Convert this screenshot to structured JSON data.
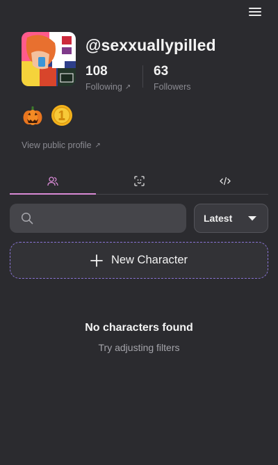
{
  "header": {
    "menu_icon": "hamburger-menu-icon"
  },
  "profile": {
    "username": "@sexxuallypilled",
    "following_count": "108",
    "following_label": "Following",
    "followers_count": "63",
    "followers_label": "Followers",
    "external_arrow": "↗",
    "badges": [
      "pumpkin-badge-icon",
      "gold-medal-badge-icon"
    ],
    "view_public_label": "View public profile"
  },
  "tabs": [
    {
      "icon": "users-icon",
      "active": true
    },
    {
      "icon": "face-scan-icon",
      "active": false
    },
    {
      "icon": "code-icon",
      "active": false
    }
  ],
  "filters": {
    "search_placeholder": "",
    "sort_value": "Latest"
  },
  "new_character": {
    "label": "New Character"
  },
  "empty_state": {
    "title": "No characters found",
    "subtitle": "Try adjusting filters"
  },
  "colors": {
    "background": "#2b2b2f",
    "accent_tab": "#d98ad6",
    "dashed_border": "#8a74d6"
  }
}
